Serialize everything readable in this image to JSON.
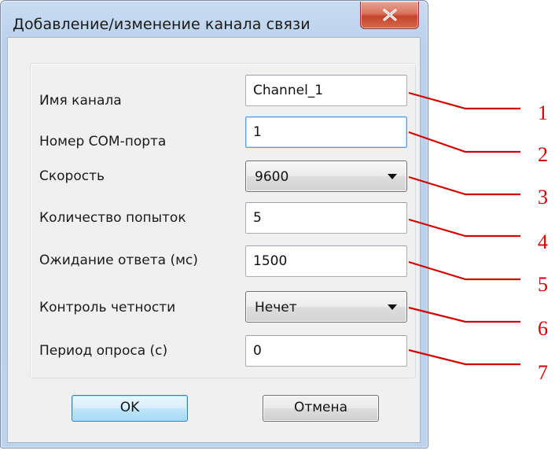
{
  "window": {
    "title": "Добавление/изменение канала связи",
    "close_glyph": "✕"
  },
  "form": {
    "rows": [
      {
        "label": "Имя канала",
        "value": "Channel_1",
        "kind": "text"
      },
      {
        "label": "Номер COM-порта",
        "value": "1",
        "kind": "text"
      },
      {
        "label": "Скорость",
        "value": "9600",
        "kind": "combo"
      },
      {
        "label": "Количество попыток",
        "value": "5",
        "kind": "text"
      },
      {
        "label": "Ожидание ответа (мс)",
        "value": "1500",
        "kind": "text"
      },
      {
        "label": "Контроль четности",
        "value": "Нечет",
        "kind": "combo"
      },
      {
        "label": "Период опроса (с)",
        "value": "0",
        "kind": "text"
      }
    ]
  },
  "buttons": {
    "ok_label": "OK",
    "cancel_label": "Отмена"
  },
  "callouts": [
    "1",
    "2",
    "3",
    "4",
    "5",
    "6",
    "7"
  ],
  "icons": {
    "close": "close-icon",
    "dropdown": "chevron-down-icon"
  },
  "colors": {
    "callout": "#d40000",
    "focus_border": "#569de5",
    "close_button": "#c4442a"
  }
}
